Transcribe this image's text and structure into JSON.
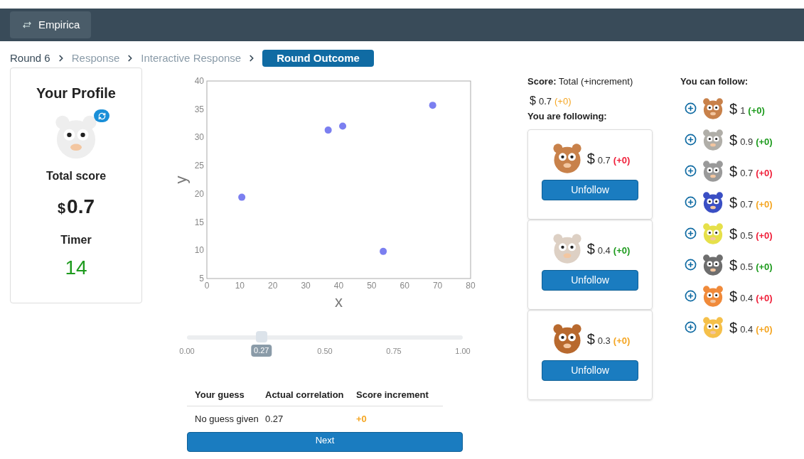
{
  "header": {
    "brand": "Empirica"
  },
  "breadcrumbs": [
    {
      "label": "Round 6",
      "selected": false,
      "done": true
    },
    {
      "label": "Response",
      "selected": false,
      "done": false
    },
    {
      "label": "Interactive Response",
      "selected": false,
      "done": false
    },
    {
      "label": "Round Outcome",
      "selected": true,
      "done": false
    }
  ],
  "profile": {
    "title": "Your Profile",
    "score_label": "Total score",
    "currency": "$",
    "score": "0.7",
    "timer_label": "Timer",
    "timer": "14"
  },
  "chart": {
    "chart_data": {
      "type": "scatter",
      "xlabel": "x",
      "ylabel": "y",
      "xlim": [
        0,
        80
      ],
      "ylim": [
        5,
        40
      ],
      "xticks": [
        {
          "value": 0,
          "label": "0"
        },
        {
          "value": 10,
          "label": "10"
        },
        {
          "value": 20,
          "label": "20"
        },
        {
          "value": 30,
          "label": "30"
        },
        {
          "value": 40,
          "label": "40"
        },
        {
          "value": 50,
          "label": "50"
        },
        {
          "value": 60,
          "label": "60"
        },
        {
          "value": 70,
          "label": "70"
        },
        {
          "value": 80,
          "label": "80"
        }
      ],
      "yticks": [
        {
          "value": 5,
          "label": "5"
        },
        {
          "value": 10,
          "label": "10"
        },
        {
          "value": 15,
          "label": "15"
        },
        {
          "value": 20,
          "label": "20"
        },
        {
          "value": 25,
          "label": "25"
        },
        {
          "value": 30,
          "label": "30"
        },
        {
          "value": 35,
          "label": "35"
        },
        {
          "value": 40,
          "label": "40"
        }
      ],
      "x": [
        10.6,
        36.8,
        41.2,
        53.5,
        68.5
      ],
      "series": [
        {
          "color": "#7b7ff0",
          "values": [
            19.4,
            31.3,
            32.0,
            9.8,
            35.7
          ]
        }
      ]
    }
  },
  "slider": {
    "level": 0.27,
    "value_label": "0.27",
    "ticks": [
      "0.00",
      "0.50",
      "0.75",
      "1.00"
    ]
  },
  "results": {
    "columns": [
      "Your guess",
      "Actual correlation",
      "Score increment"
    ],
    "rows": [
      {
        "guess": "No guess given",
        "actual": "0.27",
        "increment": "+0",
        "color": "#f5a623"
      }
    ]
  },
  "next_button": "Next",
  "score_panel": {
    "title": "**Score:** Total (+increment)",
    "currency": "$",
    "total": "0.7",
    "increment": "(+0)",
    "color": "#f5a623"
  },
  "following": {
    "title": "You are following:",
    "players": [
      {
        "currency": "$",
        "score": "0.7",
        "increment": "(+0)",
        "color": "#f0203a",
        "button": "Unfollow"
      },
      {
        "currency": "$",
        "score": "0.4",
        "increment": "(+0)",
        "color": "#1e9b1e",
        "button": "Unfollow"
      },
      {
        "currency": "$",
        "score": "0.3",
        "increment": "(+0)",
        "color": "#f5a623",
        "button": "Unfollow"
      }
    ]
  },
  "can_follow": {
    "title": "You can follow:",
    "players": [
      {
        "currency": "$",
        "score": "1",
        "increment": "(+0)",
        "color": "#1e9b1e"
      },
      {
        "currency": "$",
        "score": "0.9",
        "increment": "(+0)",
        "color": "#1e9b1e"
      },
      {
        "currency": "$",
        "score": "0.7",
        "increment": "(+0)",
        "color": "#f0203a"
      },
      {
        "currency": "$",
        "score": "0.7",
        "increment": "(+0)",
        "color": "#f5a623"
      },
      {
        "currency": "$",
        "score": "0.5",
        "increment": "(+0)",
        "color": "#f0203a"
      },
      {
        "currency": "$",
        "score": "0.5",
        "increment": "(+0)",
        "color": "#1e9b1e"
      },
      {
        "currency": "$",
        "score": "0.4",
        "increment": "(+0)",
        "color": "#f0203a"
      },
      {
        "currency": "$",
        "score": "0.4",
        "increment": "(+0)",
        "color": "#f5a623"
      }
    ]
  }
}
